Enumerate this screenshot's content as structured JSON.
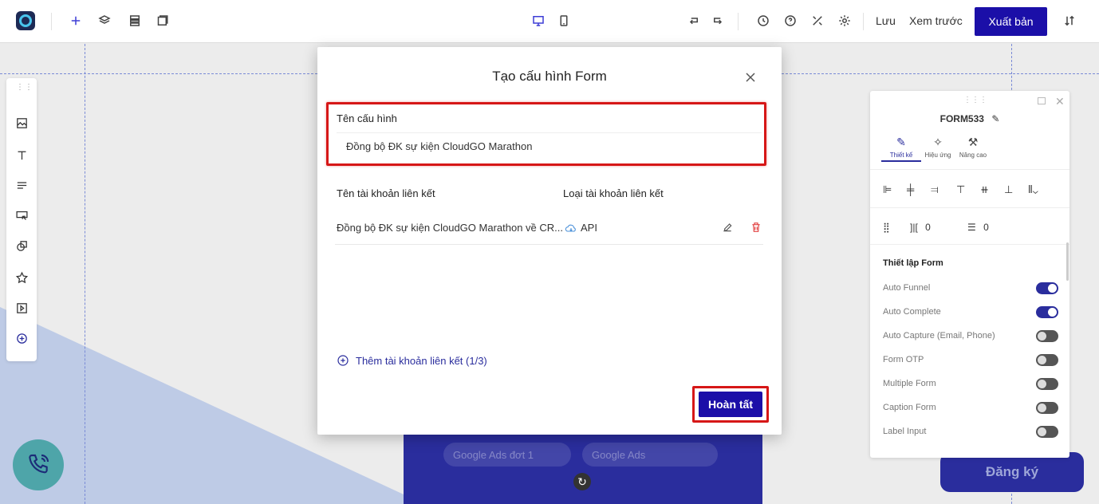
{
  "topbar": {
    "save_label": "Lưu",
    "preview_label": "Xem trước",
    "publish_label": "Xuất bản"
  },
  "canvas": {
    "ghost_field_1": "Google Ads đơt 1",
    "ghost_field_2": "Google Ads",
    "register_label": "Đăng ký"
  },
  "right_panel": {
    "title": "FORM533",
    "tabs": [
      {
        "label": "Thiết kế",
        "icon": "edit-icon"
      },
      {
        "label": "Hiệu ứng",
        "icon": "sparkle-icon"
      },
      {
        "label": "Nâng cao",
        "icon": "wrench-icon"
      }
    ],
    "spacing_h": "0",
    "spacing_v": "0",
    "section_title": "Thiết lập Form",
    "settings": [
      {
        "label": "Auto Funnel",
        "on": true
      },
      {
        "label": "Auto Complete",
        "on": true
      },
      {
        "label": "Auto Capture (Email, Phone)",
        "on": false
      },
      {
        "label": "Form OTP",
        "on": false
      },
      {
        "label": "Multiple Form",
        "on": false
      },
      {
        "label": "Caption Form",
        "on": false
      },
      {
        "label": "Label Input",
        "on": false
      }
    ]
  },
  "modal": {
    "title": "Tạo cấu hình Form",
    "config_name_label": "Tên cấu hình",
    "config_name_value": "Đồng bộ ĐK sự kiện CloudGO Marathon",
    "col_account_name": "Tên tài khoản liên kết",
    "col_account_type": "Loại tài khoản liên kết",
    "rows": [
      {
        "name": "Đồng bộ ĐK sự kiện CloudGO Marathon về CR...",
        "type": "API"
      }
    ],
    "add_link_label": "Thêm tài khoản liên kết (1/3)",
    "done_label": "Hoàn tất"
  },
  "colors": {
    "primary": "#1b0fa8",
    "highlight": "#d61717",
    "delete": "#e24444"
  }
}
